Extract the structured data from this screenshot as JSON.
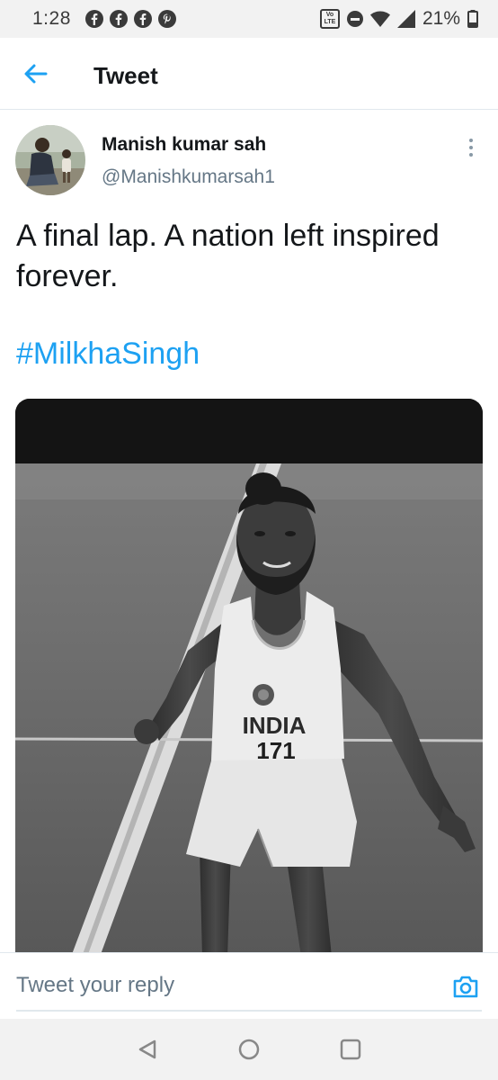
{
  "status_bar": {
    "time": "1:28",
    "notification_icons": [
      "facebook-icon",
      "facebook-icon",
      "facebook-icon",
      "pinterest-icon"
    ],
    "volte_label": "Vo\nLTE",
    "battery_percent": "21%"
  },
  "header": {
    "title": "Tweet"
  },
  "tweet": {
    "author_name": "Manish kumar sah",
    "author_handle": "@Manishkumarsah1",
    "text": "A final lap. A nation left inspired forever.",
    "hashtag": "#MilkhaSingh",
    "image_jersey_text": "INDIA",
    "image_jersey_number": "171"
  },
  "reply": {
    "placeholder": "Tweet your reply"
  },
  "colors": {
    "accent": "#1da1f2",
    "secondary_text": "#657786",
    "divider": "#e1e8ed",
    "system_bar": "#f2f2f2"
  }
}
